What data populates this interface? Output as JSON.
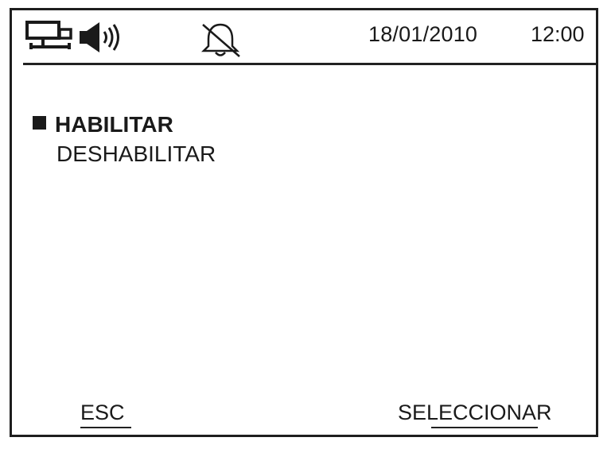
{
  "status_bar": {
    "icons": [
      "network-icon",
      "speaker-icon",
      "bell-off-icon"
    ],
    "date": "18/01/2010",
    "time": "12:00"
  },
  "menu": {
    "options": [
      {
        "label": "HABILITAR",
        "selected": true
      },
      {
        "label": "DESHABILITAR",
        "selected": false
      }
    ]
  },
  "softkeys": {
    "left": "ESC",
    "right": "SELECCIONAR"
  },
  "colors": {
    "foreground": "#1a1a1a",
    "background": "#ffffff"
  }
}
